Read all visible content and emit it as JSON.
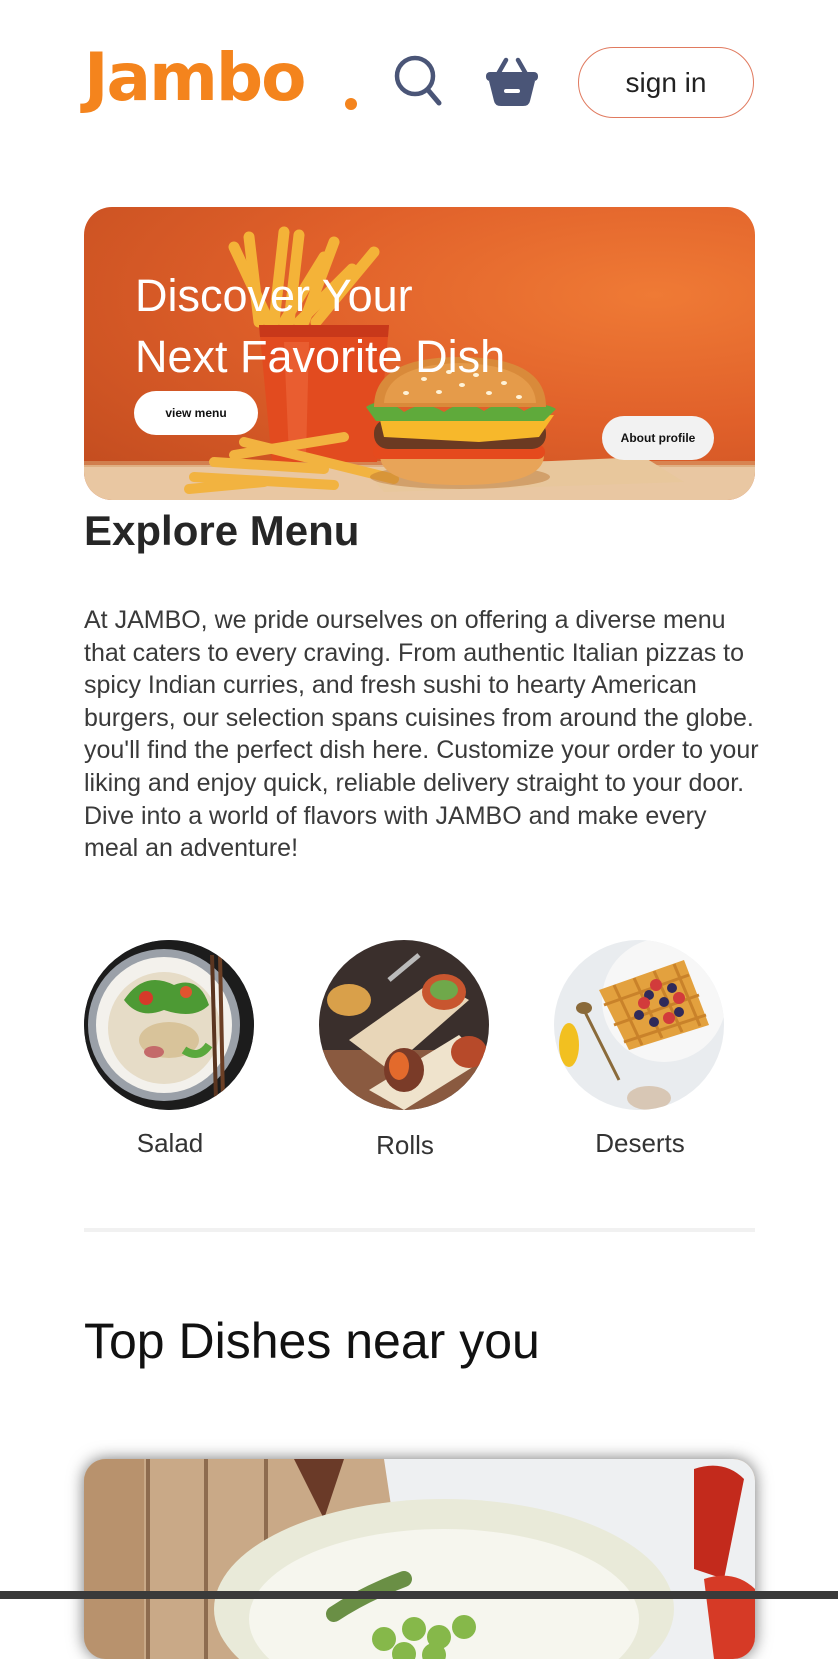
{
  "header": {
    "logo": "Jambo",
    "search_icon": "search-icon",
    "basket_icon": "basket-icon",
    "signin_label": "sign in"
  },
  "hero": {
    "title_line1": "Discover Your",
    "title_line2": "Next Favorite Dish",
    "view_menu_label": "view menu",
    "about_profile_label": "About profile"
  },
  "explore": {
    "title": "Explore Menu",
    "description": "At JAMBO, we pride ourselves on offering a diverse menu that caters to every craving. From authentic Italian pizzas to spicy Indian curries, and fresh sushi to hearty American burgers, our selection spans cuisines from around the globe. you'll find the perfect dish here. Customize your order to your liking and enjoy quick, reliable delivery straight to your door. Dive into a world of flavors with JAMBO and make every meal an adventure!",
    "categories": [
      {
        "label": "Salad"
      },
      {
        "label": "Rolls"
      },
      {
        "label": "Deserts"
      }
    ]
  },
  "top_dishes": {
    "title": "Top Dishes near you"
  },
  "colors": {
    "brand": "#f4841d",
    "icon": "#4a5577",
    "signin_border": "#e07a5f"
  }
}
